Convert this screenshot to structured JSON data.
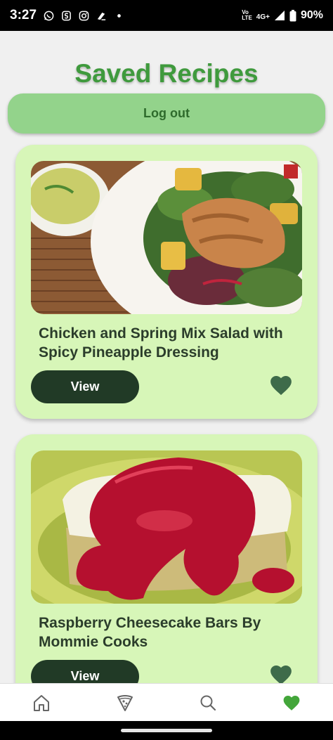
{
  "status_bar": {
    "time": "3:27",
    "battery": "90%",
    "network_line1": "Vo",
    "network_line2": "LTE",
    "network_type": "4G+",
    "icons": [
      "whatsapp-icon",
      "s-icon",
      "instagram-icon",
      "pen-icon",
      "dot-icon",
      "signal-icon",
      "battery-icon"
    ]
  },
  "header": {
    "title": "Saved Recipes",
    "logout_label": "Log out"
  },
  "recipes": [
    {
      "title": "Chicken and Spring Mix Salad with Spicy Pineapple Dressing",
      "view_label": "View",
      "favorite": true,
      "image_icon": "salad-photo"
    },
    {
      "title": "Raspberry Cheesecake Bars By Mommie Cooks",
      "view_label": "View",
      "favorite": true,
      "image_icon": "cheesecake-photo"
    }
  ],
  "bottom_nav": {
    "items": [
      "home-icon",
      "pizza-icon",
      "search-icon",
      "heart-icon"
    ],
    "active": "heart-icon"
  },
  "colors": {
    "title": "#3f9a3d",
    "logout_bg": "#93d38b",
    "card_bg": "#d7f6b8",
    "button_bg": "#213a26",
    "heart": "#3e6b4a",
    "nav_active": "#43a63a"
  }
}
